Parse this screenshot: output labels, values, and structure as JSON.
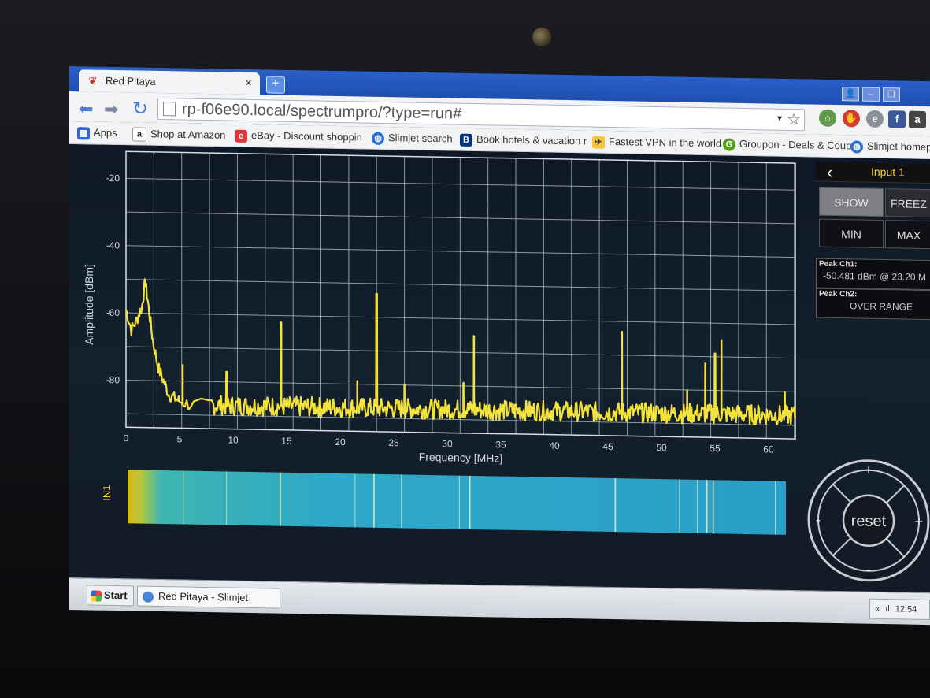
{
  "browser": {
    "tab_title": "Red Pitaya",
    "tab_close": "×",
    "new_tab": "+",
    "url": "rp-f06e90.local/spectrumpro/?type=run#"
  },
  "bookmarks": [
    {
      "label": "Apps",
      "icon": "apps-grid-icon",
      "color": "#3367d6"
    },
    {
      "label": "Shop at Amazon",
      "icon": "amazon-icon",
      "color": "#222222"
    },
    {
      "label": "eBay - Discount shoppin",
      "icon": "ebay-icon",
      "color": "#e53238"
    },
    {
      "label": "Slimjet search",
      "icon": "globe-icon",
      "color": "#2d6ec9"
    },
    {
      "label": "Book hotels & vacation r",
      "icon": "booking-icon",
      "color": "#003580"
    },
    {
      "label": "Fastest VPN in the world",
      "icon": "vpn-icon",
      "color": "#f5c542"
    },
    {
      "label": "Groupon - Deals & Coup",
      "icon": "groupon-icon",
      "color": "#53a318"
    },
    {
      "label": "Slimjet homepag",
      "icon": "globe-icon",
      "color": "#2d6ec9"
    }
  ],
  "panel": {
    "input_label": "Input 1",
    "show": "SHOW",
    "freeze": "FREEZ",
    "min": "MIN",
    "max": "MAX",
    "peak1_label": "Peak Ch1:",
    "peak1_value": "-50.481 dBm @ 23.20 M",
    "peak2_label": "Peak Ch2:",
    "peak2_value": "OVER RANGE"
  },
  "zoom": {
    "reset": "reset",
    "plus": "+",
    "minus": "-"
  },
  "waterfall_label": "IN1",
  "taskbar": {
    "start": "Start",
    "window": "Red Pitaya - Slimjet",
    "tray_arrows": "«",
    "time": "12:54"
  },
  "colors": {
    "trace": "#f2e23a",
    "grid": "#b8c3d0",
    "axis_text": "#cfd6df",
    "accent_label": "#f3cf2a"
  },
  "chart_data": {
    "type": "line",
    "xlabel": "Frequency [MHz]",
    "ylabel": "Amplitude [dBm]",
    "xlim": [
      0,
      62.5
    ],
    "ylim": [
      -94,
      -12
    ],
    "xticks": [
      0,
      5,
      10,
      15,
      20,
      25,
      30,
      35,
      40,
      45,
      50,
      55,
      60
    ],
    "yticks": [
      -20,
      -40,
      -60,
      -80
    ],
    "grid": true,
    "noise_floor": -87,
    "series": [
      {
        "x": [
          0,
          0.5,
          1.0,
          1.5,
          1.8,
          2.1,
          2.5,
          3.0,
          3.5,
          4.0,
          4.5,
          5.0,
          6.0,
          8.0
        ],
        "y": [
          -59,
          -65,
          -62,
          -58,
          -50.5,
          -58,
          -68,
          -76,
          -80,
          -84,
          -85,
          -86,
          -87,
          -87
        ]
      }
    ],
    "peaks": [
      {
        "x": 5.3,
        "y": -75
      },
      {
        "x": 9.4,
        "y": -77
      },
      {
        "x": 14.5,
        "y": -62
      },
      {
        "x": 21.6,
        "y": -79
      },
      {
        "x": 23.4,
        "y": -53
      },
      {
        "x": 26.0,
        "y": -80
      },
      {
        "x": 32.5,
        "y": -65
      },
      {
        "x": 31.5,
        "y": -79
      },
      {
        "x": 46.3,
        "y": -63
      },
      {
        "x": 52.4,
        "y": -80
      },
      {
        "x": 54.1,
        "y": -72
      },
      {
        "x": 55.0,
        "y": -69
      },
      {
        "x": 55.6,
        "y": -65
      },
      {
        "x": 61.5,
        "y": -80
      }
    ]
  }
}
